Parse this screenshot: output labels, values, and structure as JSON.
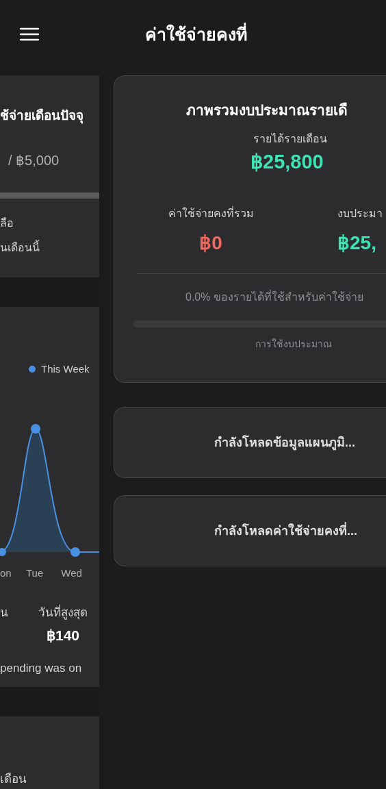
{
  "header": {
    "title": "ค่าใช้จ่ายคงที่"
  },
  "left_panel": {
    "budget_card": {
      "title": "ช้จ่ายเดือนปัจจุ",
      "limit": "/ ฿5,000",
      "lines": [
        "ลือ",
        "นเดือนนี้"
      ]
    },
    "chart_card": {
      "legend": "This Week",
      "x_labels": [
        "on",
        "Tue",
        "Wed"
      ],
      "stats": [
        {
          "label": "น"
        },
        {
          "label": "วันที่สูงสุด",
          "value": "฿140"
        }
      ],
      "note": "pending was on"
    },
    "bottom_card": {
      "text": "เดือน"
    }
  },
  "overview": {
    "title": "ภาพรวมงบประมาณรายเดื",
    "income_label": "รายได้รายเดือน",
    "income": "฿25,800",
    "stats": [
      {
        "label": "ค่าใช้จ่ายคงที่รวม",
        "value": "฿0",
        "color": "#f0695f"
      },
      {
        "label": "งบประมา",
        "value": "฿25,",
        "color": "#3de3b0"
      }
    ],
    "share": "0.0% ของรายได้ที่ใช้สำหรับค่าใช้จ่าย",
    "usage": {
      "level": 0,
      "label": "การใช้งบประมาณ"
    }
  },
  "loading": [
    "กำลังโหลดข้อมูลแผนภูมิ...",
    "กำลังโหลดค่าใช้จ่ายคงที่..."
  ]
}
